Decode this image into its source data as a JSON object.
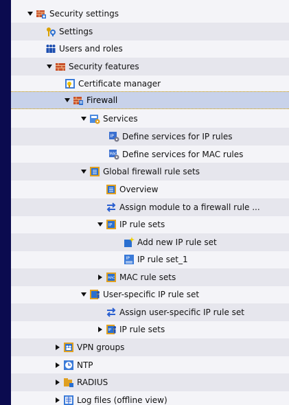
{
  "tree": {
    "items": [
      {
        "label": "Security settings",
        "expander": "expanded",
        "icon": "security-settings-icon"
      },
      {
        "label": "Settings",
        "expander": "none",
        "icon": "settings-icon"
      },
      {
        "label": "Users and roles",
        "expander": "none",
        "icon": "users-icon"
      },
      {
        "label": "Security features",
        "expander": "expanded",
        "icon": "security-features-icon"
      },
      {
        "label": "Certificate manager",
        "expander": "none",
        "icon": "certificate-icon"
      },
      {
        "label": "Firewall",
        "expander": "expanded",
        "icon": "firewall-icon",
        "selected": true
      },
      {
        "label": "Services",
        "expander": "expanded",
        "icon": "services-icon"
      },
      {
        "label": "Define services for IP rules",
        "expander": "none",
        "icon": "ip-service-icon"
      },
      {
        "label": "Define services for MAC rules",
        "expander": "none",
        "icon": "mac-service-icon"
      },
      {
        "label": "Global firewall rule sets",
        "expander": "expanded",
        "icon": "global-rules-icon"
      },
      {
        "label": "Overview",
        "expander": "none",
        "icon": "overview-icon"
      },
      {
        "label": "Assign module to a firewall rule ...",
        "expander": "none",
        "icon": "assign-icon"
      },
      {
        "label": "IP rule sets",
        "expander": "expanded",
        "icon": "ip-rule-sets-icon"
      },
      {
        "label": "Add new IP rule set",
        "expander": "none",
        "icon": "add-new-icon"
      },
      {
        "label": "IP rule set_1",
        "expander": "none",
        "icon": "ip-rule-set-icon"
      },
      {
        "label": "MAC rule sets",
        "expander": "collapsed",
        "icon": "mac-rule-sets-icon"
      },
      {
        "label": "User-specific IP rule set",
        "expander": "expanded",
        "icon": "user-rules-icon"
      },
      {
        "label": "Assign user-specific IP rule set",
        "expander": "none",
        "icon": "assign-icon"
      },
      {
        "label": "IP rule sets",
        "expander": "collapsed",
        "icon": "ip-rule-sets-user-icon"
      },
      {
        "label": "VPN groups",
        "expander": "collapsed",
        "icon": "vpn-icon"
      },
      {
        "label": "NTP",
        "expander": "collapsed",
        "icon": "ntp-icon"
      },
      {
        "label": "RADIUS",
        "expander": "collapsed",
        "icon": "radius-icon"
      },
      {
        "label": "Log files (offline view)",
        "expander": "collapsed",
        "icon": "log-files-icon"
      }
    ]
  }
}
